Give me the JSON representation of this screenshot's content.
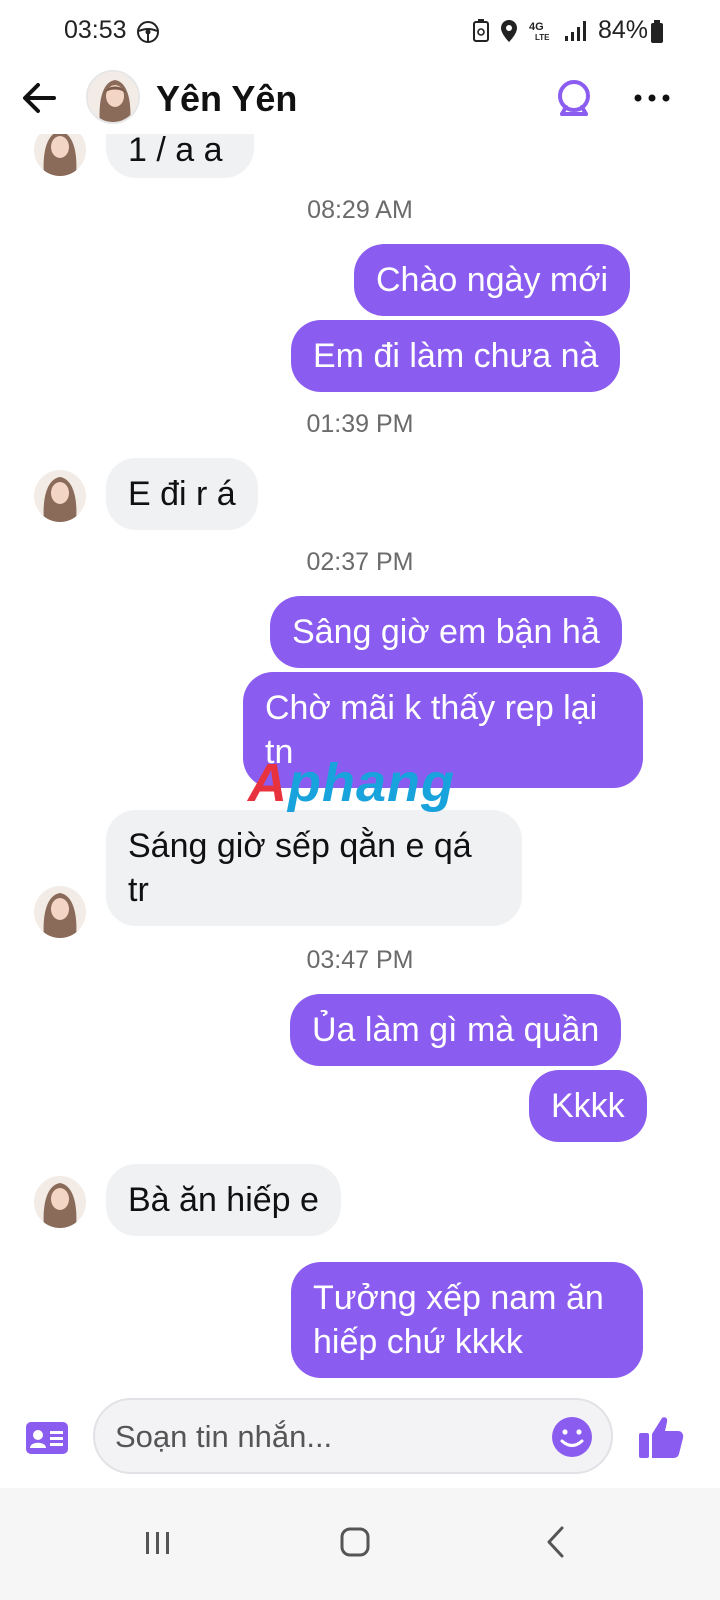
{
  "status_bar": {
    "time": "03:53",
    "battery": "84%",
    "network": "4G LTE"
  },
  "header": {
    "contact_name": "Yên Yên",
    "icons": [
      "back-arrow-icon",
      "video-call-icon",
      "more-options-icon"
    ]
  },
  "messages": {
    "partial_top": "1 / a a",
    "ts1": "08:29 AM",
    "m1": "Chào ngày mới",
    "m2": "Em đi làm chưa nà",
    "ts2": "01:39 PM",
    "m3": "E đi r á",
    "ts3": "02:37 PM",
    "m4": "Sâng giờ em bận hả",
    "m5_line1": "Chờ mãi k thấy rep lại",
    "m5_line2": "tn",
    "m6_line1": "Sáng giờ sếp qằn e qá",
    "m6_line2": "tr",
    "ts4": "03:47 PM",
    "m7": "Ủa làm gì mà quần",
    "m8": "Kkkk",
    "m9": "Bà ăn hiếp e",
    "m10_line1": "Tưởng xếp nam ăn",
    "m10_line2": "hiếp chứ kkkk"
  },
  "watermark": {
    "part1": "A",
    "part2": "phang"
  },
  "composer": {
    "placeholder": "Soạn tin nhắn..."
  },
  "colors": {
    "accent": "#8b5cf0",
    "incoming_bubble": "#f0f1f3"
  }
}
